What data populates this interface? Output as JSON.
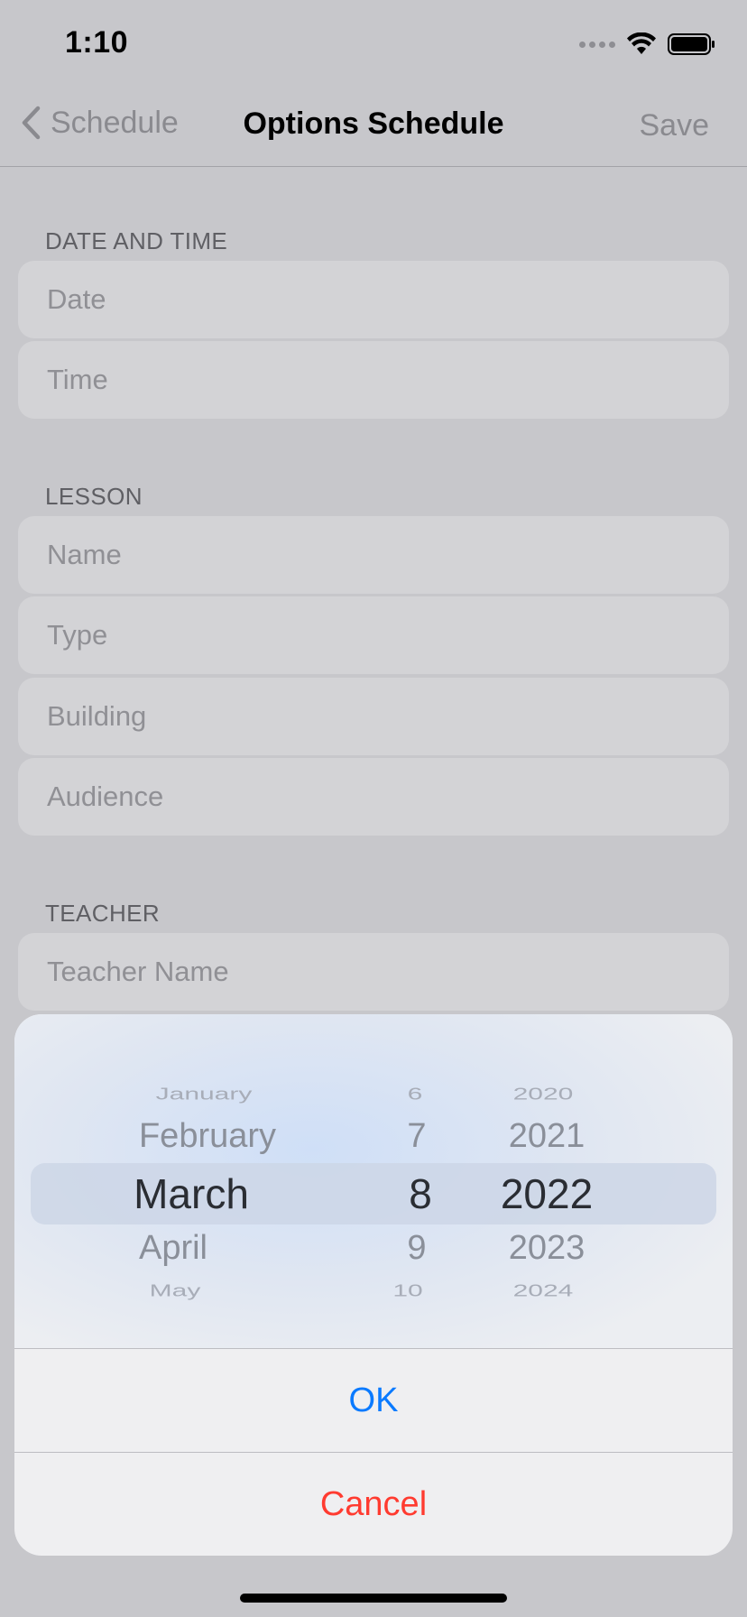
{
  "status_bar": {
    "time": "1:10"
  },
  "nav": {
    "back_label": "Schedule",
    "title": "Options Schedule",
    "save_label": "Save"
  },
  "sections": {
    "date_time": {
      "header": "DATE AND TIME",
      "date_placeholder": "Date",
      "time_placeholder": "Time"
    },
    "lesson": {
      "header": "LESSON",
      "name_placeholder": "Name",
      "type_placeholder": "Type",
      "building_placeholder": "Building",
      "audience_placeholder": "Audience"
    },
    "teacher": {
      "header": "TEACHER",
      "name_placeholder": "Teacher Name"
    }
  },
  "picker": {
    "months": [
      "January",
      "February",
      "March",
      "April",
      "May"
    ],
    "days": [
      "6",
      "7",
      "8",
      "9",
      "10"
    ],
    "years": [
      "2020",
      "2021",
      "2022",
      "2023",
      "2024"
    ],
    "selected": {
      "month": "March",
      "day": "8",
      "year": "2022"
    }
  },
  "dialog": {
    "ok_label": "OK",
    "cancel_label": "Cancel",
    "ok_color": "#0a7aff",
    "cancel_color": "#ff3b30"
  }
}
